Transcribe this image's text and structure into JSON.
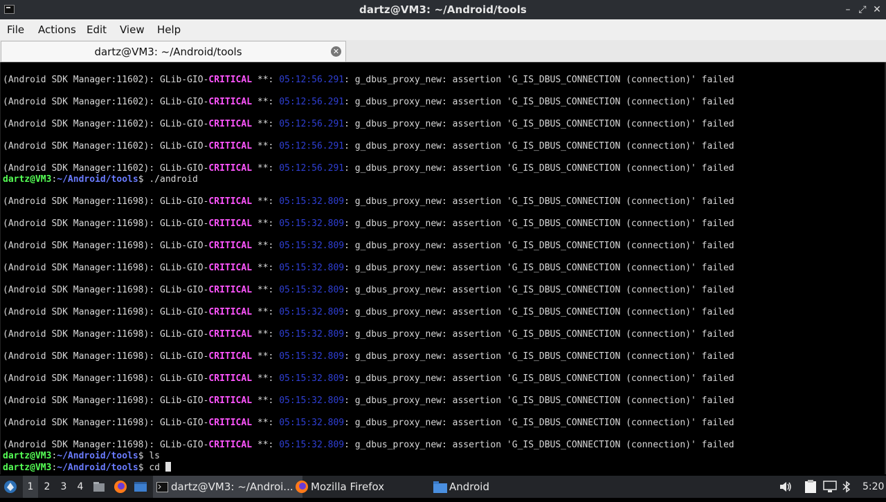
{
  "window": {
    "title": "dartz@VM3: ~/Android/tools",
    "controls": {
      "minimize": "–",
      "maximize": "⤢",
      "close": "✕"
    }
  },
  "menubar": {
    "items": [
      "File",
      "Actions",
      "Edit",
      "View",
      "Help"
    ]
  },
  "tab": {
    "label": "dartz@VM3: ~/Android/tools",
    "close": "✕"
  },
  "terminal": {
    "err_prefix_1": "(Android SDK Manager:11602): GLib-GIO-",
    "err_prefix_2": "(Android SDK Manager:11698): GLib-GIO-",
    "err_level": "CRITICAL",
    "err_mid": " **: ",
    "time_1": "05:12:56.291",
    "time_2": "05:15:32.809",
    "err_msg": ": g_dbus_proxy_new: assertion 'G_IS_DBUS_CONNECTION (connection)' failed",
    "prompt_user": "dartz@VM3",
    "prompt_sep": ":",
    "prompt_path": "~/Android/tools",
    "prompt_end": "$ ",
    "cmd_1": "./android",
    "cmd_2": "ls",
    "cmd_3": "cd "
  },
  "taskbar": {
    "workspaces": [
      "1",
      "2",
      "3",
      "4"
    ],
    "active_workspace": "1",
    "tasks": [
      {
        "label": "dartz@VM3: ~/Androi...",
        "icon": "terminal-icon"
      },
      {
        "label": "Mozilla Firefox",
        "icon": "firefox-icon"
      },
      {
        "label": "Android",
        "icon": "folder-icon"
      }
    ],
    "clock": "5:20"
  },
  "colors": {
    "critical": "#ff55ff",
    "timestamp": "#2f3fd4",
    "prompt_user": "#55ff55",
    "prompt_path": "#6a7cff"
  }
}
